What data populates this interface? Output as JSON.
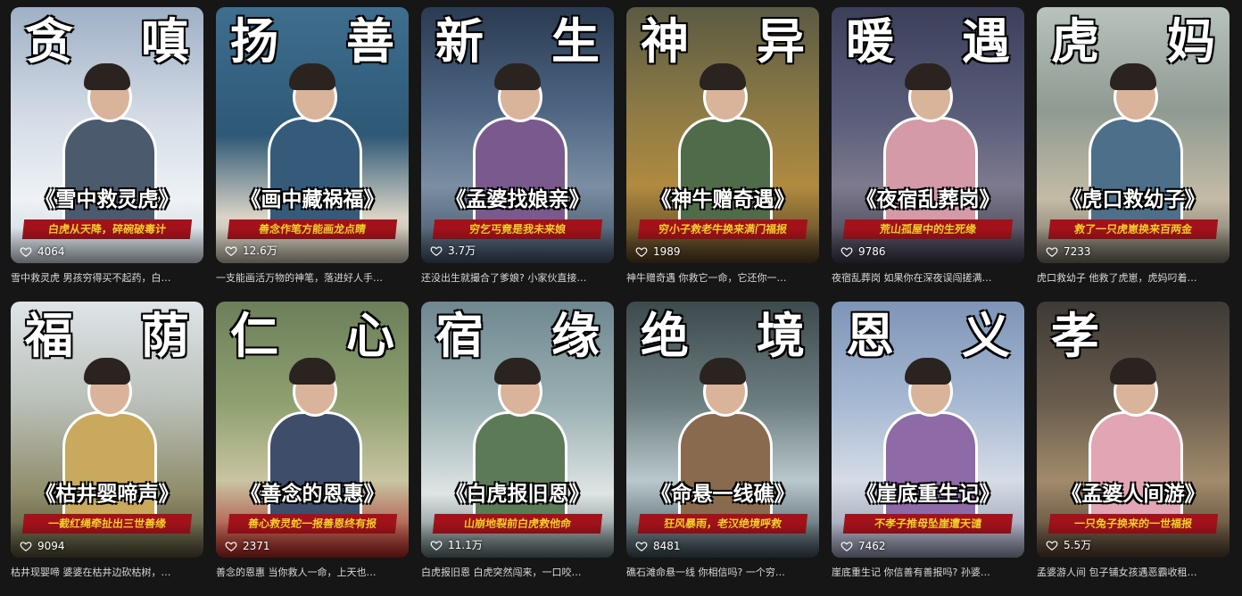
{
  "cards": [
    {
      "big_left": "贪",
      "big_right": "嗔",
      "title": "《雪中救灵虎》",
      "subtitle": "白虎从天降，碎碗破毒计",
      "likes": "4064",
      "desc": "雪中救灵虎 男孩穷得买不起药，白…",
      "bg": "linear-gradient(180deg,#9fb0c6 0%,#d6dde7 45%,#eef2f6 75%,#c9d2dc 100%)",
      "cloth": "#4c5a6e"
    },
    {
      "big_left": "扬",
      "big_right": "善",
      "title": "《画中藏祸福》",
      "subtitle": "善念作笔方能画龙点睛",
      "likes": "12.6万",
      "desc": "一支能画活万物的神笔，落进好人手…",
      "bg": "linear-gradient(180deg,#3f6e8e 0%,#2e5876 50%,#d9d4c6 82%,#b9b2a2 100%)",
      "cloth": "#365a7a"
    },
    {
      "big_left": "新",
      "big_right": "生",
      "title": "《孟婆找娘亲》",
      "subtitle": "穷乞丐竟是我未来娘",
      "likes": "3.7万",
      "desc": "还没出生就撮合了爹娘? 小家伙直接…",
      "bg": "linear-gradient(180deg,#2a3b52 0%,#4e6583 40%,#7b8ea3 70%,#3e4d60 100%)",
      "cloth": "#7a5a8e"
    },
    {
      "big_left": "神",
      "big_right": "异",
      "title": "《神牛赠奇遇》",
      "subtitle": "穷小子救老牛换来满门福报",
      "likes": "1989",
      "desc": "神牛赠奇遇 你救它一命，它还你一…",
      "bg": "linear-gradient(180deg,#5b5a44 0%,#8c7a45 40%,#b08a40 70%,#4d3a22 100%)",
      "cloth": "#4f6b4a"
    },
    {
      "big_left": "暖",
      "big_right": "遇",
      "title": "《夜宿乱葬岗》",
      "subtitle": "荒山孤屋中的生死缘",
      "likes": "9786",
      "desc": "夜宿乱葬岗 如果你在深夜误闯搓满…",
      "bg": "linear-gradient(180deg,#3c3f5a 0%,#5c5f7c 45%,#7e7a8e 70%,#3a3848 100%)",
      "cloth": "#d49aa8"
    },
    {
      "big_left": "虎",
      "big_right": "妈",
      "title": "《虎口救幼子》",
      "subtitle": "救了一只虎崽换来百两金",
      "likes": "7233",
      "desc": "虎口救幼子 他救了虎崽，虎妈叼着…",
      "bg": "linear-gradient(180deg,#b7c3bc 0%,#8e9a92 40%,#c4bba6 75%,#6c675c 100%)",
      "cloth": "#4e6f8a"
    },
    {
      "big_left": "福",
      "big_right": "荫",
      "title": "《枯井婴啼声》",
      "subtitle": "一截红绳牵扯出三世善缘",
      "likes": "9094",
      "desc": "枯井现婴啼 婆婆在枯井边砍枯树，…",
      "bg": "linear-gradient(180deg,#dfe4e8 0%,#b9bfb8 40%,#8f8c6a 75%,#4e4a35 100%)",
      "cloth": "#c9a95e"
    },
    {
      "big_left": "仁",
      "big_right": "心",
      "title": "《善念的恩惠》",
      "subtitle": "善心救灵蛇一报善恩终有报",
      "likes": "2371",
      "desc": "善念的恩惠 当你救人一命，上天也…",
      "bg": "linear-gradient(180deg,#6c7f5a 0%,#8fa070 40%,#c9c4a2 70%,#a3231f 100%)",
      "cloth": "#3e4e6a"
    },
    {
      "big_left": "宿",
      "big_right": "缘",
      "title": "《白虎报旧恩》",
      "subtitle": "山崩地裂前白虎救他命",
      "likes": "11.1万",
      "desc": "白虎报旧恩 白虎突然闯来，一口咬…",
      "bg": "linear-gradient(180deg,#6f8790 0%,#9ab0b2 40%,#dfe4e4 75%,#5a6b6c 100%)",
      "cloth": "#5d7a58"
    },
    {
      "big_left": "绝",
      "big_right": "境",
      "title": "《命悬一线礁》",
      "subtitle": "狂风暴雨，老汉绝境呼救",
      "likes": "8481",
      "desc": "礁石滩命悬一线 你相信吗? 一个穷…",
      "bg": "linear-gradient(180deg,#3d4a4e 0%,#6d7e80 40%,#b9c8cc 70%,#3a4a52 100%)",
      "cloth": "#8a6a4e"
    },
    {
      "big_left": "恩",
      "big_right": "义",
      "title": "《崖底重生记》",
      "subtitle": "不孝子推母坠崖遭天谴",
      "likes": "7462",
      "desc": "崖底重生记 你信善有善报吗? 孙婆…",
      "bg": "linear-gradient(180deg,#7e95b8 0%,#a7b9d3 40%,#d6dce6 70%,#8c8fa6 100%)",
      "cloth": "#8e6aa6"
    },
    {
      "big_left": "孝",
      "big_right": "",
      "title": "《孟婆人间游》",
      "subtitle": "一只兔子换来的一世福报",
      "likes": "5.5万",
      "desc": "孟婆游人间 包子铺女孩遇恶霸收租…",
      "bg": "linear-gradient(180deg,#3e3a36 0%,#6a5d4e 40%,#a18b6c 70%,#4a3a2c 100%)",
      "cloth": "#e2a5b4"
    }
  ]
}
